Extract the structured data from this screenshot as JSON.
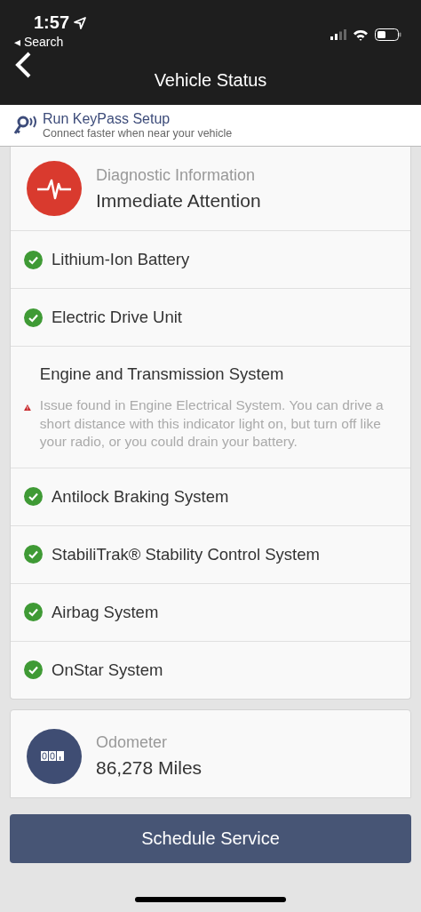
{
  "status_bar": {
    "time": "1:57",
    "back_label": "◂ Search"
  },
  "nav": {
    "title": "Vehicle Status"
  },
  "keypass": {
    "title": "Run KeyPass Setup",
    "subtitle": "Connect faster when near your vehicle"
  },
  "diagnostic": {
    "label": "Diagnostic Information",
    "status": "Immediate Attention"
  },
  "systems": [
    {
      "name": "Lithium-Ion Battery",
      "kind": "ok"
    },
    {
      "name": "Electric Drive Unit",
      "kind": "ok"
    },
    {
      "name": "Engine and Transmission System",
      "kind": "warning",
      "detail": "Issue found in Engine Electrical System.  You can drive a short distance with this indicator light on, but turn off like your radio, or you could drain your battery."
    },
    {
      "name": "Antilock Braking System",
      "kind": "ok"
    },
    {
      "name": "StabiliTrak® Stability Control System",
      "kind": "ok"
    },
    {
      "name": "Airbag System",
      "kind": "ok"
    },
    {
      "name": "OnStar System",
      "kind": "ok"
    }
  ],
  "odometer": {
    "label": "Odometer",
    "value": "86,278 Miles"
  },
  "button": "Schedule Service"
}
